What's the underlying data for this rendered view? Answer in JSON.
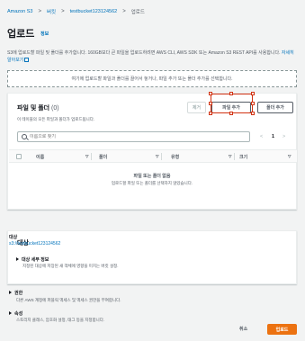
{
  "breadcrumb": {
    "items": [
      "Amazon S3",
      "버킷",
      "testbucket123124562"
    ],
    "current": "업로드",
    "separator": ">"
  },
  "page": {
    "title": "업로드",
    "info_link": "정보",
    "description": "S3에 업로드할 파일 및 폴더를 추가합니다. 160GB보다 큰 파일을 업로드하려면 AWS CLI, AWS SDK 또는 Amazon S3 REST API를 사용합니다.",
    "more_link": "자세히 알아보기"
  },
  "dropzone": {
    "text": "여기에 업로드할 파일과 폴더를 끌어서 놓거나, 파일 추가 또는 폴더 추가를 선택합니다."
  },
  "files": {
    "title": "파일 및 폴더",
    "count": "(0)",
    "subtitle": "이 테이블의 모든 파일과 폴더가 업로드됩니다.",
    "remove_label": "제거",
    "add_files_label": "파일 추가",
    "add_folder_label": "폴더 추가",
    "search_placeholder": "이름으로 찾기",
    "pagination": {
      "prev": "<",
      "page": "1",
      "next": ">"
    },
    "columns": [
      "이름",
      "폴더",
      "유형",
      "크기"
    ],
    "empty_title": "파일 또는 폴더 없음",
    "empty_subtitle": "업로드할 파일 또는 폴더를 선택하지 않았습니다."
  },
  "destination": {
    "title": "대상",
    "label": "대상",
    "bucket_link": "s3://testbucket123124562",
    "details_title": "대상 세부 정보",
    "details_desc": "지정된 대상에 저장된 새 객체에 영향을 미치는 버킷 설정."
  },
  "permissions": {
    "title": "권한",
    "desc": "다른 AWS 계정에 퍼블릭 액세스 및 액세스 권한을 부여합니다."
  },
  "properties": {
    "title": "속성",
    "desc": "스토리지 클래스, 암호화 설정, 태그 등을 지정합니다."
  },
  "footer": {
    "cancel_label": "취소",
    "upload_label": "업로드"
  },
  "colors": {
    "link": "#0073bb",
    "primary": "#ec7211",
    "selection": "#d13212"
  }
}
